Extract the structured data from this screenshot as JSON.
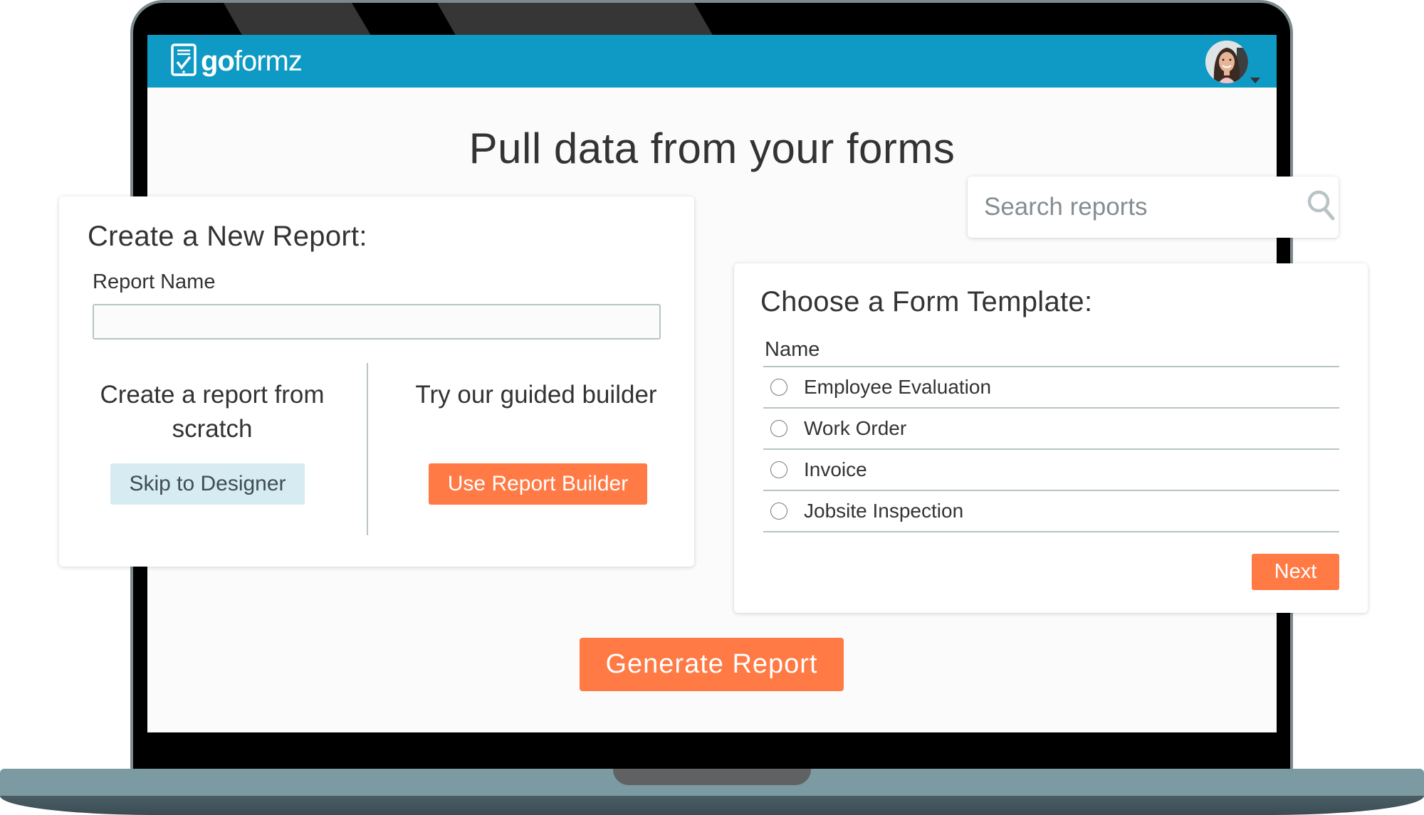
{
  "app": {
    "brand_bold": "go",
    "brand_light": "formz",
    "logo_icon": "tablet-checkmark-icon",
    "avatar_icon": "user-avatar",
    "avatar_menu_icon": "caret-down-icon",
    "colors": {
      "header": "#0e9ac4",
      "accent": "#ff7a45",
      "secondary_button": "#d7ebf2",
      "divider": "#b8c4c6"
    }
  },
  "page": {
    "title": "Pull data from your forms"
  },
  "create_report": {
    "heading": "Create a New Report:",
    "report_name_label": "Report Name",
    "report_name_value": "",
    "scratch_text": "Create a report from scratch",
    "skip_button": "Skip to Designer",
    "guided_text": "Try our guided builder",
    "builder_button": "Use Report Builder"
  },
  "search": {
    "placeholder": "Search reports",
    "value": "",
    "icon": "search-icon"
  },
  "template_picker": {
    "heading": "Choose a Form Template:",
    "column_header": "Name",
    "rows": [
      {
        "label": "Employee Evaluation",
        "selected": false
      },
      {
        "label": "Work Order",
        "selected": false
      },
      {
        "label": "Invoice",
        "selected": false
      },
      {
        "label": "Jobsite Inspection",
        "selected": false
      }
    ],
    "next_button": "Next"
  },
  "actions": {
    "generate_button": "Generate Report"
  }
}
